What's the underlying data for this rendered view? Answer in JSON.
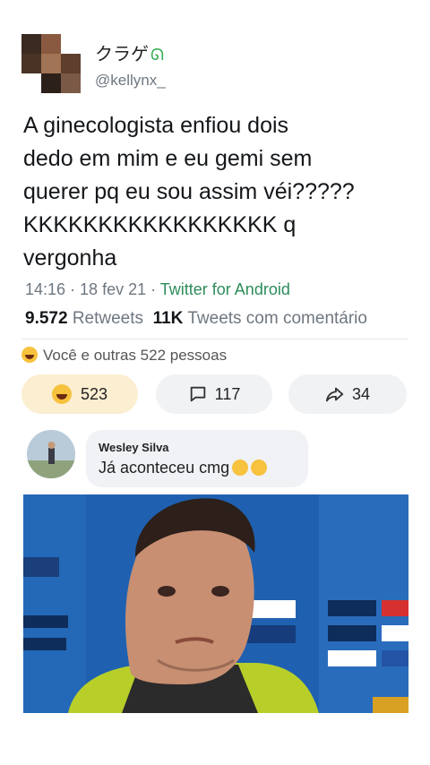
{
  "tweet": {
    "name": "クラゲ",
    "handle": "@kellynx_",
    "text_lines": [
      "A ginecologista enfiou dois",
      "dedo em mim e eu gemi sem",
      "querer pq eu sou assim véi?????",
      "KKKKKKKKKKKKKKKKK q",
      "vergonha"
    ],
    "time": "14:16 · 18 fev 21 · ",
    "app": "Twitter for Android",
    "retweets_value": "9.572",
    "retweets_label": " Retweets",
    "quotes_value": "11K",
    "quotes_label": " Tweets com comentário"
  },
  "reactions": {
    "summary": "Você e outras 522 pessoas",
    "laugh_count": "523",
    "comment_count": "117",
    "share_count": "34"
  },
  "comment": {
    "author": "Wesley Silva",
    "text": "Já aconteceu cmg"
  },
  "colors": {
    "accent_green": "#2c8c5a",
    "laugh_bg": "#fbeed1",
    "emoji": "#f7c23d"
  }
}
